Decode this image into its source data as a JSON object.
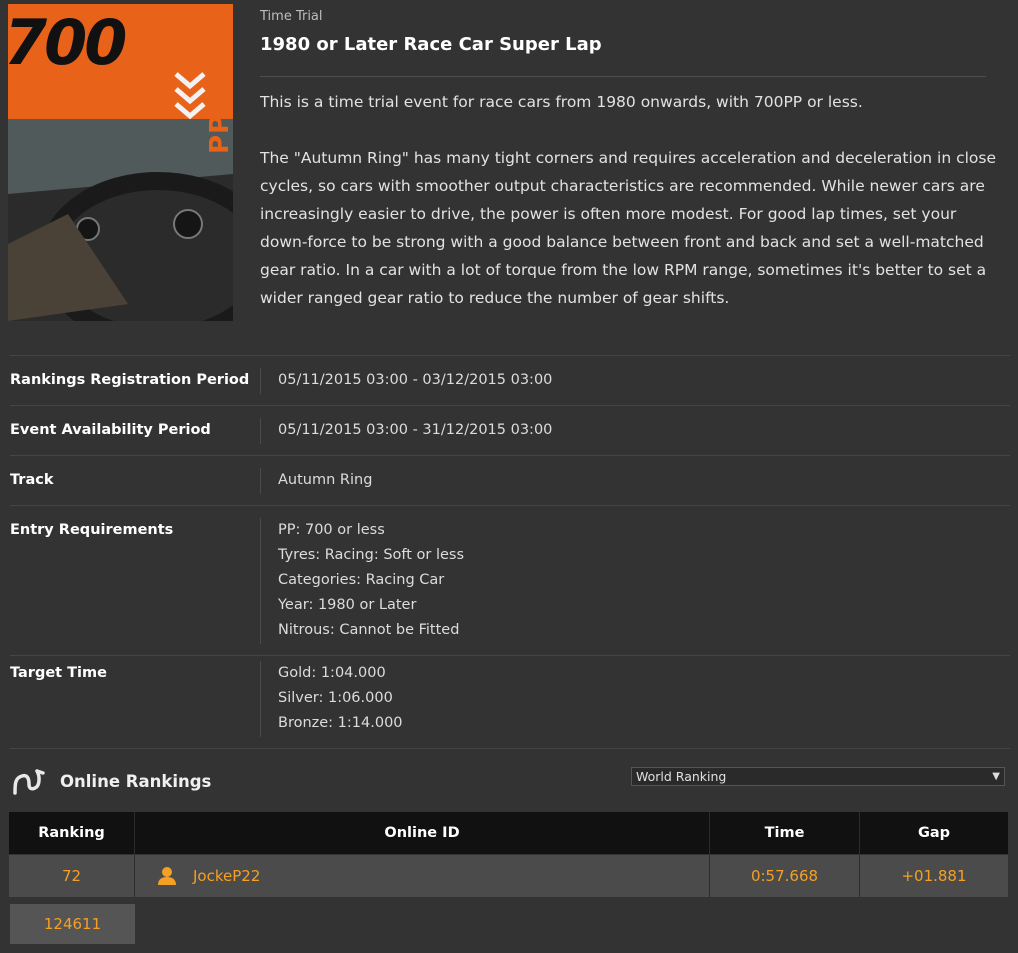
{
  "event": {
    "category": "Time Trial",
    "title": "1980 or Later Race Car Super Lap",
    "description": [
      "This is a time trial event for race cars from 1980 onwards, with 700PP or less.",
      "The \"Autumn Ring\" has many tight corners and requires acceleration and deceleration in close cycles, so cars with smoother output characteristics are recommended. While newer cars are increasingly easier to drive, the power is often more modest. For good lap times, set your down-force to be strong with a good balance between front and back and set a well-matched gear ratio. In a car with a lot of torque from the low RPM range, sometimes it's better to set a wider ranged gear ratio to reduce the number of gear shifts."
    ],
    "image": {
      "badge_number": "700",
      "badge_text": "PP LIMIT",
      "accent_color": "#e8621a"
    }
  },
  "details": [
    {
      "label": "Rankings Registration Period",
      "values": [
        "05/11/2015 03:00 - 03/12/2015 03:00"
      ]
    },
    {
      "label": "Event Availability Period",
      "values": [
        "05/11/2015 03:00 - 31/12/2015 03:00"
      ]
    },
    {
      "label": "Track",
      "values": [
        "Autumn Ring"
      ]
    },
    {
      "label": "Entry Requirements",
      "values": [
        "PP: 700 or less",
        "Tyres: Racing: Soft or less",
        "Categories: Racing Car",
        "Year: 1980 or Later",
        "Nitrous: Cannot be Fitted"
      ]
    },
    {
      "label": "Target Time",
      "values": [
        "Gold: 1:04.000",
        "Silver: 1:06.000",
        "Bronze: 1:14.000"
      ]
    }
  ],
  "rankings": {
    "title": "Online Rankings",
    "icon": "track-icon",
    "dropdown_selected": "World Ranking",
    "columns": [
      "Ranking",
      "Online ID",
      "Time",
      "Gap"
    ],
    "rows": [
      {
        "ranking": "72",
        "online_id": "JockeP22",
        "time": "0:57.668",
        "gap": "+01.881",
        "icon": "user-icon"
      }
    ],
    "total_entries": "124611",
    "highlight_color": "#f4a025"
  }
}
